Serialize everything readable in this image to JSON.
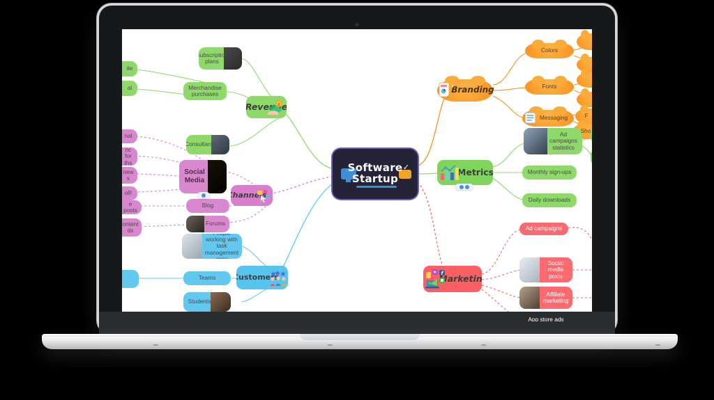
{
  "device": {
    "type": "laptop-mockup",
    "brand_style": "silver-macbook"
  },
  "mindmap": {
    "root": {
      "line1": "Software",
      "line2": "Startup",
      "icons": [
        "monitor-icon",
        "check-icon",
        "display-icon"
      ]
    },
    "branches": [
      {
        "id": "revenue",
        "label": "Revenue",
        "color": "#8ed96a",
        "side": "left",
        "icon": "money-hand-icon",
        "children": [
          {
            "label": "Subscription plans",
            "has_image": true
          },
          {
            "label": "Merchandise purchases",
            "has_image": false
          },
          {
            "label": "Consultants",
            "has_image": true
          }
        ],
        "cut_children": [
          {
            "label": "ite"
          },
          {
            "label": "al"
          }
        ]
      },
      {
        "id": "channels",
        "label": "Channels",
        "color": "#d97ecd",
        "side": "left",
        "icon": "click-cursor-icon",
        "children": [
          {
            "label": "Social Media",
            "is_sub_parent": true,
            "has_image": true
          },
          {
            "label": "Blog",
            "has_image": false
          },
          {
            "label": "Forums",
            "has_image": true
          }
        ],
        "cut_children": [
          {
            "label": "nal"
          },
          {
            "label": "nc for ths"
          },
          {
            "label": "new s"
          },
          {
            "label": "oll!"
          },
          {
            "label": "e posts"
          },
          {
            "label": "ontent ds"
          }
        ]
      },
      {
        "id": "customers",
        "label": "Customers",
        "color": "#57c4ef",
        "side": "left",
        "icon": "users-stars-icon",
        "children": [
          {
            "label": "People working with task management apps",
            "has_image": true
          },
          {
            "label": "Teams",
            "has_image": false
          },
          {
            "label": "Students",
            "has_image": true
          }
        ],
        "cut_children": [
          {
            "label": ""
          }
        ]
      },
      {
        "id": "branding",
        "label": "Branding",
        "color": "#f7921e",
        "side": "right",
        "shape": "cloud",
        "icon": "design-palette-icon",
        "children": [
          {
            "label": "Colors"
          },
          {
            "label": "Fonts"
          },
          {
            "label": "Messaging",
            "has_image": true
          }
        ],
        "cut_children": [
          {
            "label": ""
          },
          {
            "label": ""
          },
          {
            "label": ""
          },
          {
            "label": ""
          },
          {
            "label": "F"
          },
          {
            "label": "Sho"
          }
        ]
      },
      {
        "id": "metrics",
        "label": "Metrics",
        "color": "#7fd45c",
        "side": "right",
        "icon": "bar-chart-icon",
        "children": [
          {
            "label": "Ad campaigns statistics",
            "has_image": true
          },
          {
            "label": "Monthly sign-ups",
            "has_image": false
          },
          {
            "label": "Daily downloads",
            "has_image": false
          }
        ],
        "cut_children": [
          {
            "label": ""
          },
          {
            "label": ""
          }
        ]
      },
      {
        "id": "marketing",
        "label": "Marketing",
        "color": "#fa5f63",
        "side": "right",
        "icon": "megaphone-social-icon",
        "children": [
          {
            "label": "Ad campaigns",
            "has_image": false
          },
          {
            "label": "Social media posts",
            "has_image": true
          },
          {
            "label": "Affiliate marketing",
            "has_image": true
          },
          {
            "label": "App store ads",
            "has_image": false
          }
        ]
      }
    ]
  }
}
